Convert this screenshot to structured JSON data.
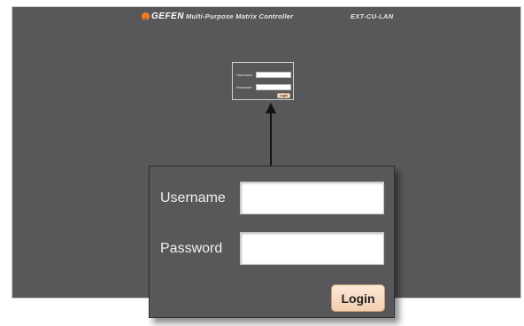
{
  "header": {
    "brand": "GEFEN",
    "app_title": "Multi-Purpose Matrix Controller",
    "model": "EXT-CU-LAN"
  },
  "mini_login": {
    "username_label": "Username",
    "password_label": "Password",
    "login_label": "Login"
  },
  "zoom_login": {
    "username_label": "Username",
    "password_label": "Password",
    "login_label": "Login",
    "username_value": "",
    "password_value": ""
  },
  "colors": {
    "background": "#58585a",
    "button_face": "#f7dfc9",
    "brand_accent": "#f47a1f"
  },
  "icons": [
    "gefen-logo-icon",
    "arrow-up-icon"
  ]
}
